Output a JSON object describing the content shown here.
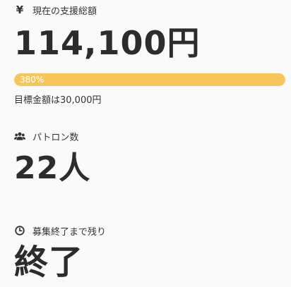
{
  "funding": {
    "label": "現在の支援総額",
    "icon": "yen-icon",
    "icon_glyph": "¥",
    "amount": "114,100円",
    "progress_text": "380%",
    "progress_fraction": 1.0,
    "progress_color": "#f6c65a",
    "goal": "目標金額は30,000円"
  },
  "patrons": {
    "label": "パトロン数",
    "icon": "users-icon",
    "count": "22人"
  },
  "remaining": {
    "label": "募集終了まで残り",
    "icon": "clock-icon",
    "value": "終了"
  }
}
